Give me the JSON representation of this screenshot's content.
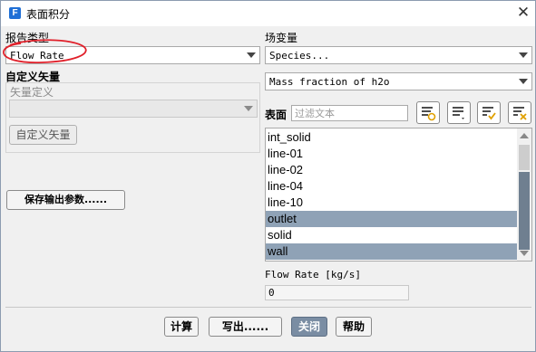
{
  "window": {
    "title": "表面积分",
    "app_icon_letter": "F"
  },
  "left": {
    "report_type_label": "报告类型",
    "report_type_value": "Flow Rate",
    "custom_vector_label": "自定义矢量",
    "vector_def_label": "矢量定义",
    "vector_def_value": "",
    "custom_vector_button": "自定义矢量",
    "save_params_button": "保存输出参数......"
  },
  "right": {
    "field_variable_label": "场变量",
    "field_category_value": "Species...",
    "field_variable_value": "Mass fraction of h2o",
    "surface_label": "表面",
    "filter_placeholder": "过滤文本",
    "surfaces": [
      {
        "name": "int_solid",
        "selected": false
      },
      {
        "name": "line-01",
        "selected": false
      },
      {
        "name": "line-02",
        "selected": false
      },
      {
        "name": "line-04",
        "selected": false
      },
      {
        "name": "line-10",
        "selected": false
      },
      {
        "name": "outlet",
        "selected": true
      },
      {
        "name": "solid",
        "selected": false
      },
      {
        "name": "wall",
        "selected": true
      }
    ],
    "result_label": "Flow Rate [kg/s]",
    "result_value": "0"
  },
  "footer": {
    "compute_button": "计算",
    "write_button": "写出......",
    "close_button": "关闭",
    "help_button": "帮助"
  },
  "colors": {
    "selection": "#8fa2b6",
    "primary_button": "#7a8da3",
    "annotation": "#e0202a"
  },
  "icons": [
    "app-icon",
    "close-icon",
    "select-all-icon",
    "deselect-all-icon",
    "check-list-icon",
    "clear-list-icon",
    "dropdown-arrow-icon"
  ]
}
